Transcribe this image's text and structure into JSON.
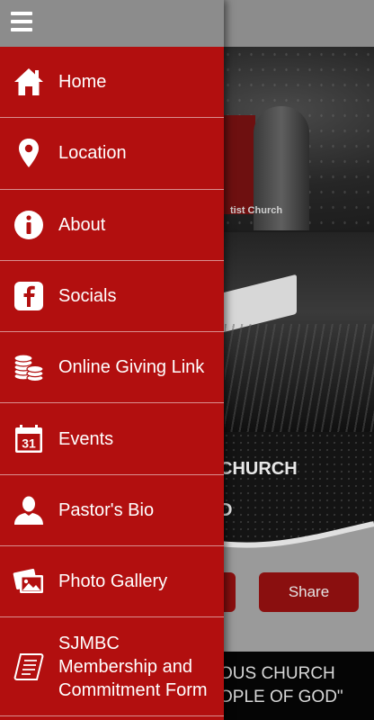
{
  "background": {
    "hero_church_name_partial": "tist Church",
    "title_line1_partial": "CHURCH",
    "title_line2_partial": "D",
    "share_button": "Share",
    "quote_line1_partial": "OUS CHURCH",
    "quote_line2_partial": "OPLE OF GOD\""
  },
  "drawer": {
    "menu_icon": "hamburger-menu-icon",
    "items": [
      {
        "label": "Home",
        "icon": "home-icon"
      },
      {
        "label": "Location",
        "icon": "map-pin-icon"
      },
      {
        "label": "About",
        "icon": "info-icon"
      },
      {
        "label": "Socials",
        "icon": "facebook-icon"
      },
      {
        "label": "Online Giving Link",
        "icon": "coins-icon"
      },
      {
        "label": "Events",
        "icon": "calendar-icon"
      },
      {
        "label": "Pastor's Bio",
        "icon": "person-icon"
      },
      {
        "label": "Photo Gallery",
        "icon": "photos-icon"
      },
      {
        "label": "SJMBC Membership and Commitment Form",
        "icon": "form-scroll-icon"
      }
    ],
    "calendar_day": "31"
  },
  "colors": {
    "drawer_red": "#b20f0f",
    "header_gray": "#8c8c8c",
    "button_red": "#8a0f0f"
  }
}
